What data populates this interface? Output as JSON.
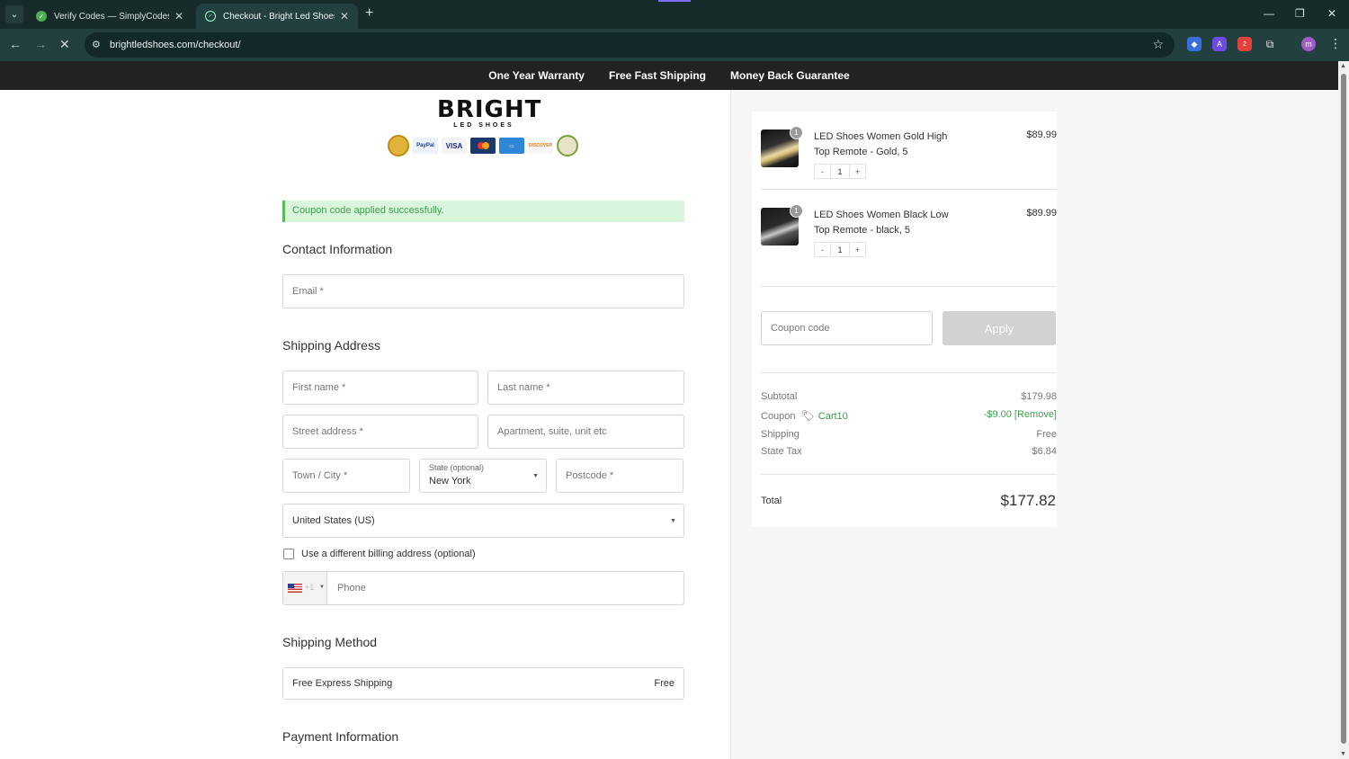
{
  "browser": {
    "tabs": [
      {
        "title": "Verify Codes — SimplyCodes"
      },
      {
        "title": "Checkout - Bright Led Shoes"
      }
    ],
    "url": "brightledshoes.com/checkout/",
    "extension_badge": "2",
    "profile_initial": "m"
  },
  "promo_bar": {
    "items": [
      "One Year Warranty",
      "Free Fast Shipping",
      "Money Back Guarantee"
    ]
  },
  "logo": {
    "main": "BRIGHT",
    "sub": "LED SHOES"
  },
  "payment_badges": [
    "PayPal",
    "VISA",
    "DISCOVER"
  ],
  "notice": "Coupon code applied successfully.",
  "contact": {
    "title": "Contact Information",
    "email_placeholder": "Email *"
  },
  "shipping_address": {
    "title": "Shipping Address",
    "first_name": "First name *",
    "last_name": "Last name *",
    "street": "Street address *",
    "apartment": "Apartment, suite, unit etc",
    "city": "Town / City *",
    "state_label": "State (optional)",
    "state_value": "New York",
    "postcode": "Postcode *",
    "country": "United States (US)",
    "billing_checkbox": "Use a different billing address (optional)",
    "phone_dial": "+1",
    "phone_placeholder": "Phone"
  },
  "shipping_method": {
    "title": "Shipping Method",
    "option_name": "Free Express Shipping",
    "option_price": "Free"
  },
  "payment": {
    "title": "Payment Information"
  },
  "order": {
    "items": [
      {
        "name": "LED Shoes Women Gold High Top Remote - Gold, 5",
        "price": "$89.99",
        "qty": "1"
      },
      {
        "name": "LED Shoes Women Black Low Top Remote - black, 5",
        "price": "$89.99",
        "qty": "1"
      }
    ],
    "stepper_minus": "-",
    "stepper_plus": "+",
    "coupon_placeholder": "Coupon code",
    "apply_label": "Apply",
    "subtotal_label": "Subtotal",
    "subtotal": "$179.98",
    "coupon_label": "Coupon",
    "coupon_code": "Cart10",
    "coupon_discount": "-$9.00 [Remove]",
    "shipping_label": "Shipping",
    "shipping_value": "Free",
    "tax_label": "State Tax",
    "tax_value": "$6.84",
    "total_label": "Total",
    "total_value": "$177.82"
  }
}
